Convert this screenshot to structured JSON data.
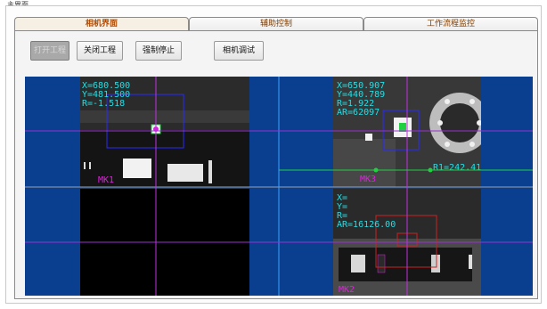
{
  "window": {
    "title": "主界面"
  },
  "tabs": [
    {
      "label": "相机界面",
      "active": true
    },
    {
      "label": "辅助控制",
      "active": false
    },
    {
      "label": "工作流程监控",
      "active": false
    }
  ],
  "toolbar": {
    "open_label": "打开工程",
    "close_label": "关闭工程",
    "stop_label": "强制停止",
    "debug_label": "相机调试"
  },
  "cameras": {
    "top_left": {
      "line1": "X=680.500",
      "line2": "Y=481.500",
      "line3": "R=-1.518",
      "mark": "MK1"
    },
    "top_right": {
      "line1": "X=650.907",
      "line2": "Y=440.789",
      "line3": "R=1.922",
      "line4": "AR=62097",
      "side_label": "R1=242.41"
    },
    "bottom_right": {
      "line1": "X=",
      "line2": "Y=",
      "line3": "R=",
      "line4": "AR=16126.00",
      "mark": "MK2"
    }
  },
  "colors": {
    "view_background": "#0a3f8f",
    "crosshair_vertical": "#c030e0",
    "crosshair_horizontal": "#9a30d0",
    "green_line": "#20d040",
    "overlay_text": "#1ee0e8",
    "mark_text": "#e020e0",
    "roi_box_blue": "#2a2aff",
    "roi_box_red": "#d02020"
  }
}
